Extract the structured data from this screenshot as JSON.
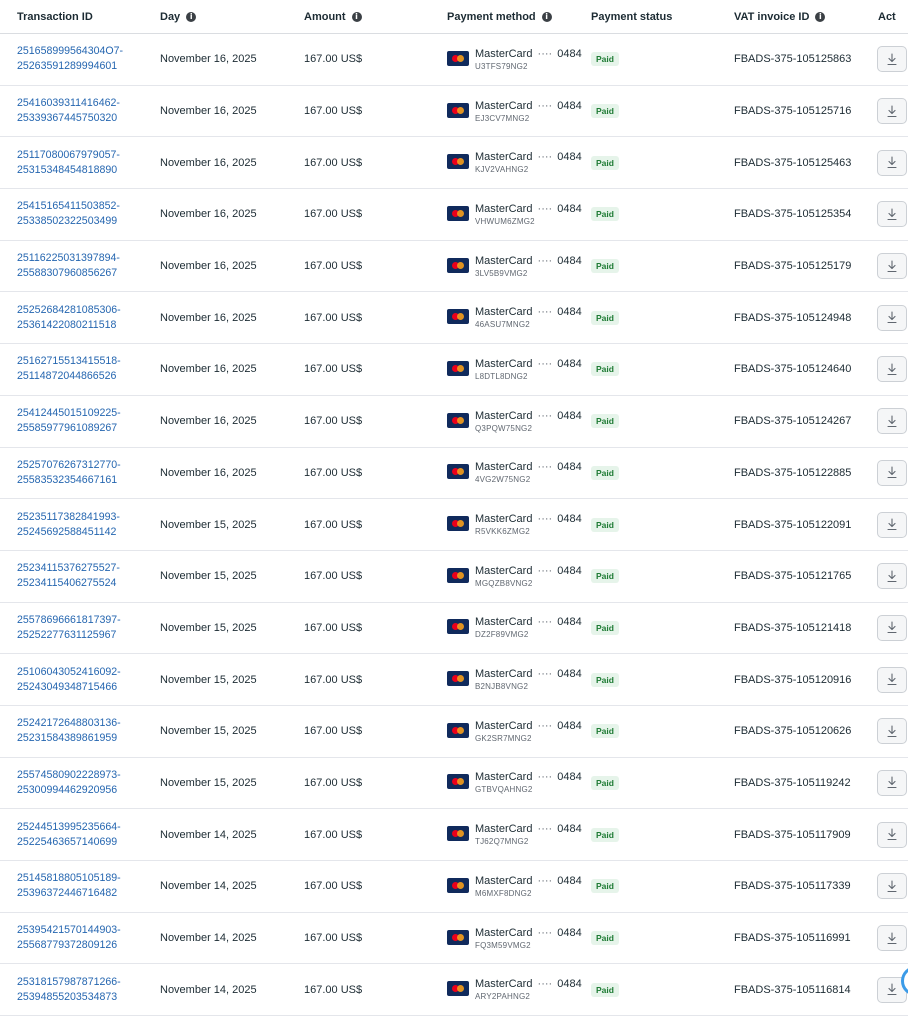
{
  "headers": {
    "transaction_id": "Transaction ID",
    "day": "Day",
    "amount": "Amount",
    "payment_method": "Payment method",
    "payment_status": "Payment status",
    "vat_invoice_id": "VAT invoice ID",
    "action": "Act"
  },
  "info_glyph": "i",
  "card_dots": "····",
  "colors": {
    "link": "#2566b0",
    "paid_bg": "#e6f4ea",
    "paid_text": "#1e7b34",
    "card_bg": "#102a5c"
  },
  "rows": [
    {
      "tid1": "251658999564304O7-",
      "tid2": "25263591289994601",
      "day": "November 16, 2025",
      "amount": "167.00 US$",
      "card": "MasterCard",
      "last4": "0484",
      "ref": "U3TFS79NG2",
      "status": "Paid",
      "vat": "FBADS-375-105125863"
    },
    {
      "tid1": "25416039311416462-",
      "tid2": "25339367445750320",
      "day": "November 16, 2025",
      "amount": "167.00 US$",
      "card": "MasterCard",
      "last4": "0484",
      "ref": "EJ3CV7MNG2",
      "status": "Paid",
      "vat": "FBADS-375-105125716"
    },
    {
      "tid1": "25117080067979057-",
      "tid2": "25315348454818890",
      "day": "November 16, 2025",
      "amount": "167.00 US$",
      "card": "MasterCard",
      "last4": "0484",
      "ref": "KJV2VAHNG2",
      "status": "Paid",
      "vat": "FBADS-375-105125463"
    },
    {
      "tid1": "25415165411503852-",
      "tid2": "25338502322503499",
      "day": "November 16, 2025",
      "amount": "167.00 US$",
      "card": "MasterCard",
      "last4": "0484",
      "ref": "VHWUM6ZMG2",
      "status": "Paid",
      "vat": "FBADS-375-105125354"
    },
    {
      "tid1": "25116225031397894-",
      "tid2": "25588307960856267",
      "day": "November 16, 2025",
      "amount": "167.00 US$",
      "card": "MasterCard",
      "last4": "0484",
      "ref": "3LV5B9VMG2",
      "status": "Paid",
      "vat": "FBADS-375-105125179"
    },
    {
      "tid1": "25252684281085306-",
      "tid2": "25361422080211518",
      "day": "November 16, 2025",
      "amount": "167.00 US$",
      "card": "MasterCard",
      "last4": "0484",
      "ref": "46ASU7MNG2",
      "status": "Paid",
      "vat": "FBADS-375-105124948"
    },
    {
      "tid1": "25162715513415518-",
      "tid2": "25114872044866526",
      "day": "November 16, 2025",
      "amount": "167.00 US$",
      "card": "MasterCard",
      "last4": "0484",
      "ref": "L8DTL8DNG2",
      "status": "Paid",
      "vat": "FBADS-375-105124640"
    },
    {
      "tid1": "25412445015109225-",
      "tid2": "25585977961089267",
      "day": "November 16, 2025",
      "amount": "167.00 US$",
      "card": "MasterCard",
      "last4": "0484",
      "ref": "Q3PQW75NG2",
      "status": "Paid",
      "vat": "FBADS-375-105124267"
    },
    {
      "tid1": "25257076267312770-",
      "tid2": "25583532354667161",
      "day": "November 16, 2025",
      "amount": "167.00 US$",
      "card": "MasterCard",
      "last4": "0484",
      "ref": "4VG2W75NG2",
      "status": "Paid",
      "vat": "FBADS-375-105122885"
    },
    {
      "tid1": "25235117382841993-",
      "tid2": "25245692588451142",
      "day": "November 15, 2025",
      "amount": "167.00 US$",
      "card": "MasterCard",
      "last4": "0484",
      "ref": "R5VKK6ZMG2",
      "status": "Paid",
      "vat": "FBADS-375-105122091"
    },
    {
      "tid1": "25234115376275527-",
      "tid2": "25234115406275524",
      "day": "November 15, 2025",
      "amount": "167.00 US$",
      "card": "MasterCard",
      "last4": "0484",
      "ref": "MGQZB8VNG2",
      "status": "Paid",
      "vat": "FBADS-375-105121765"
    },
    {
      "tid1": "25578696661817397-",
      "tid2": "25252277631125967",
      "day": "November 15, 2025",
      "amount": "167.00 US$",
      "card": "MasterCard",
      "last4": "0484",
      "ref": "DZ2F89VMG2",
      "status": "Paid",
      "vat": "FBADS-375-105121418"
    },
    {
      "tid1": "25106043052416092-",
      "tid2": "25243049348715466",
      "day": "November 15, 2025",
      "amount": "167.00 US$",
      "card": "MasterCard",
      "last4": "0484",
      "ref": "B2NJB8VNG2",
      "status": "Paid",
      "vat": "FBADS-375-105120916"
    },
    {
      "tid1": "25242172648803136-",
      "tid2": "25231584389861959",
      "day": "November 15, 2025",
      "amount": "167.00 US$",
      "card": "MasterCard",
      "last4": "0484",
      "ref": "GK2SR7MNG2",
      "status": "Paid",
      "vat": "FBADS-375-105120626"
    },
    {
      "tid1": "25574580902228973-",
      "tid2": "25300994462920956",
      "day": "November 15, 2025",
      "amount": "167.00 US$",
      "card": "MasterCard",
      "last4": "0484",
      "ref": "GTBVQAHNG2",
      "status": "Paid",
      "vat": "FBADS-375-105119242"
    },
    {
      "tid1": "25244513995235664-",
      "tid2": "25225463657140699",
      "day": "November 14, 2025",
      "amount": "167.00 US$",
      "card": "MasterCard",
      "last4": "0484",
      "ref": "TJ62Q7MNG2",
      "status": "Paid",
      "vat": "FBADS-375-105117909"
    },
    {
      "tid1": "25145818805105189-",
      "tid2": "25396372446716482",
      "day": "November 14, 2025",
      "amount": "167.00 US$",
      "card": "MasterCard",
      "last4": "0484",
      "ref": "M6MXF8DNG2",
      "status": "Paid",
      "vat": "FBADS-375-105117339"
    },
    {
      "tid1": "25395421570144903-",
      "tid2": "25568779372809126",
      "day": "November 14, 2025",
      "amount": "167.00 US$",
      "card": "MasterCard",
      "last4": "0484",
      "ref": "FQ3M59VMG2",
      "status": "Paid",
      "vat": "FBADS-375-105116991"
    },
    {
      "tid1": "25318157987871266-",
      "tid2": "25394855203534873",
      "day": "November 14, 2025",
      "amount": "167.00 US$",
      "card": "MasterCard",
      "last4": "0484",
      "ref": "ARY2PAHNG2",
      "status": "Paid",
      "vat": "FBADS-375-105116814"
    }
  ]
}
